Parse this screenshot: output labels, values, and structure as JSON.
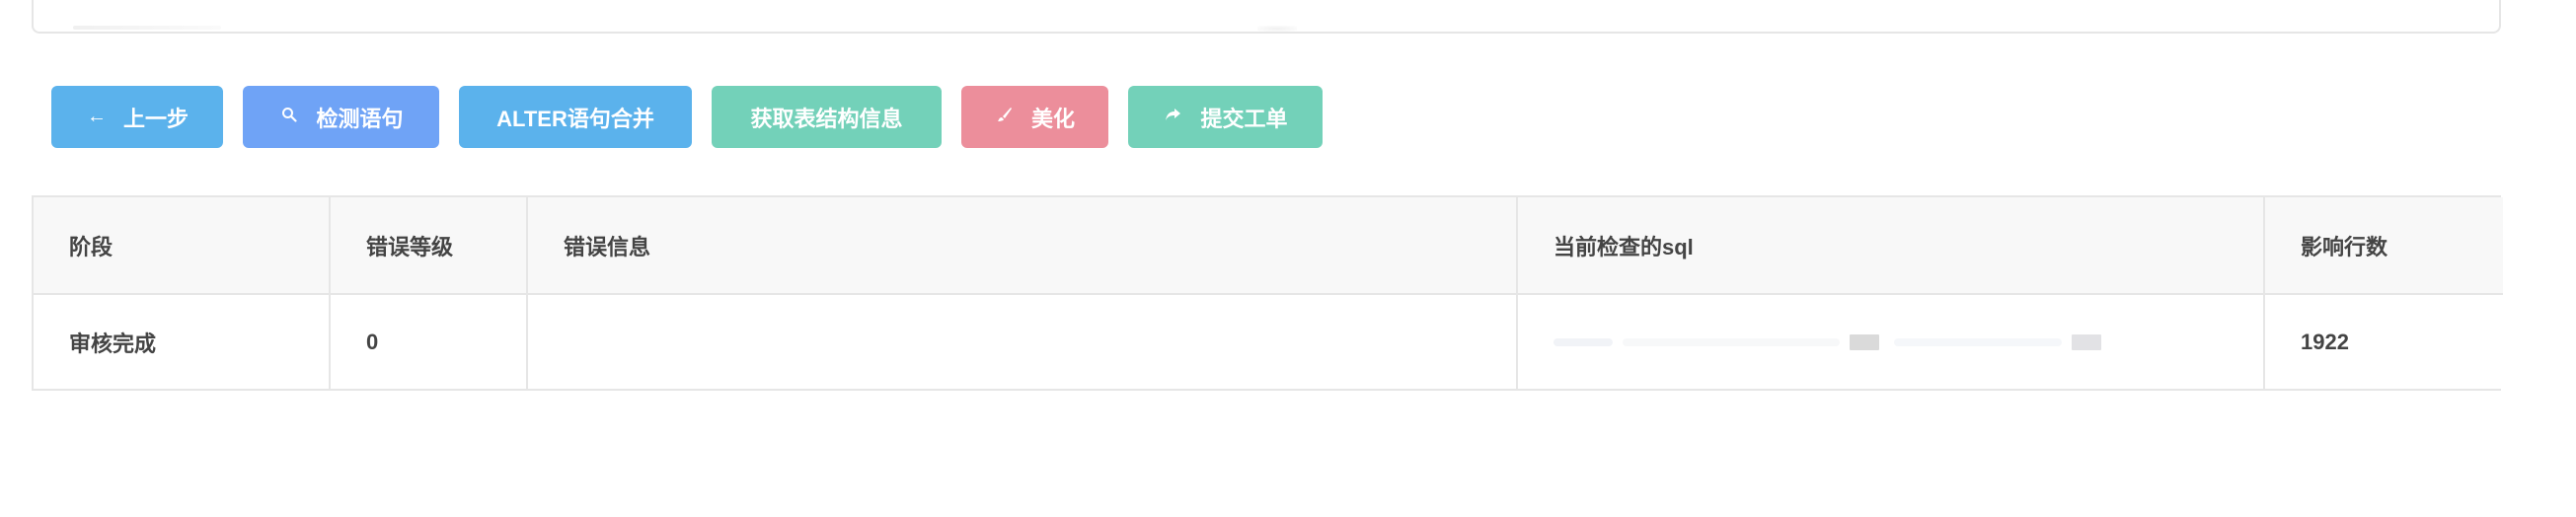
{
  "toolbar": {
    "prev_label": "上一步",
    "check_label": "检测语句",
    "alter_label": "ALTER语句合并",
    "struct_label": "获取表结构信息",
    "beautify_label": "美化",
    "submit_label": "提交工单",
    "colors": {
      "prev": "#5bb2ec",
      "check": "#6fa3f6",
      "alter": "#5bb2ec",
      "struct": "#73d1b9",
      "beautify": "#ec8e9b",
      "submit": "#73d1b9"
    }
  },
  "table": {
    "headers": [
      "阶段",
      "错误等级",
      "错误信息",
      "当前检查的sql",
      "影响行数"
    ],
    "rows": [
      {
        "stage": "审核完成",
        "error_level": "0",
        "error_message": "",
        "sql": "",
        "affected_rows": "1922"
      }
    ]
  }
}
